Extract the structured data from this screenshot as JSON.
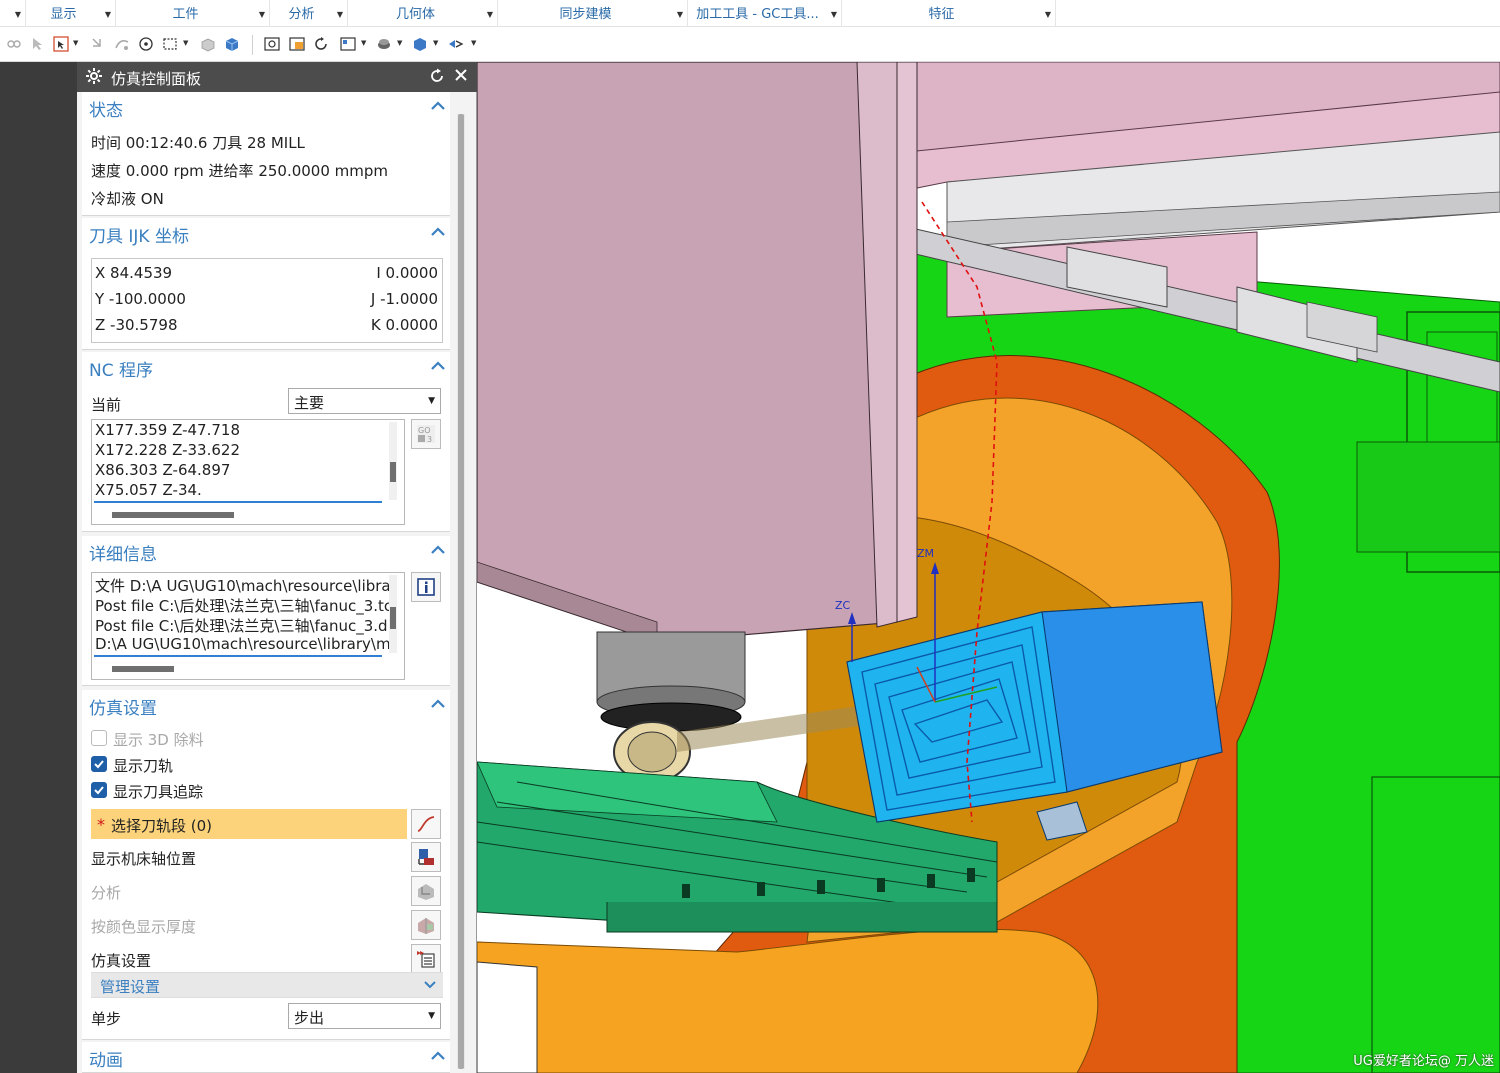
{
  "ribbon": {
    "tabs": [
      {
        "label": "显示"
      },
      {
        "label": "工件"
      },
      {
        "label": "分析"
      },
      {
        "label": "几何体"
      },
      {
        "label": "同步建模"
      },
      {
        "label": "加工工具 - GC工具..."
      },
      {
        "label": "特征"
      }
    ]
  },
  "panel": {
    "title": "仿真控制面板",
    "status": {
      "header": "状态",
      "time_line": "时间 00:12:40.6 刀具 28   MILL",
      "speed_line": "速度 0.000 rpm 进给率 250.0000 mmpm",
      "coolant_line": "冷却液 ON"
    },
    "ijk": {
      "header": "刀具 IJK 坐标",
      "x": "X 84.4539",
      "y": "Y -100.0000",
      "z": "Z -30.5798",
      "i": "I 0.0000",
      "j": "J -1.0000",
      "k": "K 0.0000"
    },
    "nc": {
      "header": "NC 程序",
      "current_label": "当前",
      "current_value": "主要",
      "lines": [
        "X177.359 Z-47.718",
        "X172.228 Z-33.622",
        "X86.303 Z-64.897",
        "X75.057 Z-34."
      ],
      "go_icon_text": "GO"
    },
    "details": {
      "header": "详细信息",
      "lines": [
        "文件 D:\\A UG\\UG10\\mach\\resource\\libra",
        "Post file C:\\后处理\\法兰克\\三轴\\fanuc_3.tc",
        "Post file C:\\后处理\\法兰克\\三轴\\fanuc_3.d",
        "D:\\A UG\\UG10\\mach\\resource\\library\\m"
      ]
    },
    "sim": {
      "header": "仿真设置",
      "show_3d_removal": "显示 3D 除料",
      "show_toolpath": "显示刀轨",
      "show_tool_trace": "显示刀具追踪",
      "select_segment": "选择刀轨段 (0)",
      "show_axis_pos": "显示机床轴位置",
      "analysis": "分析",
      "thickness_by_color": "按颜色显示厚度",
      "sim_settings": "仿真设置",
      "manage_settings": "管理设置",
      "step_label": "单步",
      "step_value": "步出"
    },
    "animation": {
      "header": "动画"
    }
  },
  "viewport": {
    "labels": {
      "zm": "ZM",
      "zc": "ZC"
    },
    "watermark": "UG爱好者论坛@ 万人迷"
  }
}
